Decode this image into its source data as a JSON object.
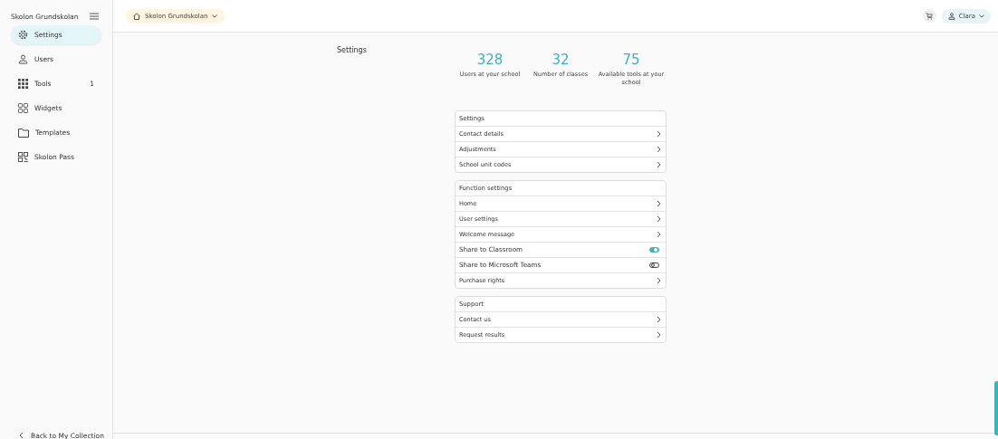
{
  "sidebar": {
    "title": "Skolon Grundskolan",
    "items": [
      {
        "label": "Settings",
        "selected": true
      },
      {
        "label": "Users",
        "selected": false
      },
      {
        "label": "Tools",
        "selected": false,
        "count": "1"
      },
      {
        "label": "Widgets",
        "selected": false
      },
      {
        "label": "Templates",
        "selected": false
      },
      {
        "label": "Skolon Pass",
        "selected": false
      }
    ],
    "back_link": "Back to My Collection"
  },
  "topbar": {
    "school": "Skolon Grundskolan",
    "user": "Clara"
  },
  "page_title": "Settings",
  "stats": [
    {
      "value": "328",
      "label": "Users at your school"
    },
    {
      "value": "32",
      "label": "Number of classes"
    },
    {
      "value": "75",
      "label": "Available tools at your school"
    }
  ],
  "panels": [
    {
      "title": "Settings",
      "rows": [
        {
          "label": "Contact details",
          "kind": "link"
        },
        {
          "label": "Adjustments",
          "kind": "link"
        },
        {
          "label": "School unit codes",
          "kind": "link"
        }
      ]
    },
    {
      "title": "Function settings",
      "rows": [
        {
          "label": "Home",
          "kind": "link"
        },
        {
          "label": "User settings",
          "kind": "link"
        },
        {
          "label": "Welcome message",
          "kind": "link"
        },
        {
          "label": "Share to Classroom",
          "kind": "toggle",
          "on": true
        },
        {
          "label": "Share to Microsoft Teams",
          "kind": "toggle",
          "on": false
        },
        {
          "label": "Purchase rights",
          "kind": "link"
        }
      ]
    },
    {
      "title": "Support",
      "rows": [
        {
          "label": "Contact us",
          "kind": "link"
        },
        {
          "label": "Request results",
          "kind": "link"
        }
      ]
    }
  ]
}
